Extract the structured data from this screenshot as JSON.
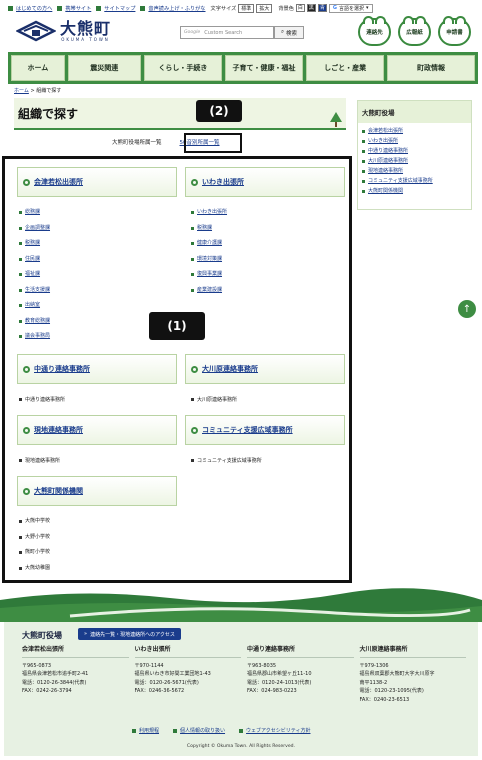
{
  "utility": {
    "links": [
      "はじめての方へ",
      "携帯サイト",
      "サイトマップ",
      "音声読み上げ・ふりがな"
    ],
    "font_size_label": "文字サイズ",
    "font_std": "標準",
    "font_large": "拡大",
    "bg_label": "背景色",
    "bg_options": [
      "白",
      "黒",
      "青"
    ],
    "lang_label": "言語を選択"
  },
  "header": {
    "logo_text": "大熊町",
    "logo_sub": "OKUMA TOWN",
    "search_placeholder": "Custom Search",
    "search_brand": "Google",
    "search_button": "検索",
    "quick_links": [
      "連絡先",
      "広報紙",
      "申請書"
    ]
  },
  "gnav": [
    "ホーム",
    "震災関連",
    "くらし・手続き",
    "子育て・健康・福祉",
    "しごと・産業",
    "町政情報"
  ],
  "breadcrumb": {
    "home": "ホーム",
    "current": "組織で探す"
  },
  "page_title": "組織で探す",
  "subnav": {
    "current": "大熊町役場所属一覧",
    "link": "50音別所属一覧"
  },
  "callouts": {
    "one": "(1)",
    "two": "(2)"
  },
  "org": {
    "aizu": {
      "title": "会津若松出張所",
      "items": [
        "総務課",
        "企画調整課",
        "税務課",
        "住民課",
        "福祉課",
        "生活支援課",
        "出納室",
        "教育総務課",
        "議会事務局"
      ]
    },
    "iwaki": {
      "title": "いわき出張所",
      "items": [
        "いわき出張所",
        "税務課",
        "健康介護課",
        "環境対策課",
        "復興事業課",
        "産業建設課"
      ]
    },
    "nakadori": {
      "title": "中通り連絡事務所",
      "items": [
        "中通り連絡事務所"
      ]
    },
    "okawara": {
      "title": "大川原連絡事務所",
      "items": [
        "大川原連絡事務所"
      ]
    },
    "genchi": {
      "title": "現地連絡事務所",
      "items": [
        "現地連絡事務所"
      ]
    },
    "community": {
      "title": "コミュニティ支援広域事務所",
      "items": [
        "コミュニティ支援広域事務所"
      ]
    },
    "kankei": {
      "title": "大熊町関係機関",
      "items": [
        "大熊中学校",
        "大野小学校",
        "熊町小学校",
        "大熊幼稚園"
      ]
    }
  },
  "side": {
    "heading": "大熊町役場",
    "items": [
      "会津若松出張所",
      "いわき出張所",
      "中通り連絡事務所",
      "大川原連絡事務所",
      "現地連絡事務所",
      "コミュニティ支援広域事務所",
      "大熊町関係機関"
    ]
  },
  "footer": {
    "title": "大熊町役場",
    "access": "連絡先一覧・現地連絡所へのアクセス",
    "columns": [
      {
        "name": "会津若松出張所",
        "lines": [
          "〒965-0873",
          "福島県会津若松市追手町2-41",
          "電話：0120-26-3844(代表)",
          "FAX：0242-26-3794"
        ]
      },
      {
        "name": "いわき出張所",
        "lines": [
          "〒970-1144",
          "福島県いわき市好間工業団地1-43",
          "電話：0120-26-5671(代表)",
          "FAX：0246-36-5672"
        ]
      },
      {
        "name": "中通り連絡事務所",
        "lines": [
          "〒963-8035",
          "福島県郡山市希望ヶ丘11-10",
          "電話：0120-24-1013(代表)",
          "FAX：024-983-0223"
        ]
      },
      {
        "name": "大川原連絡事務所",
        "lines": [
          "〒979-1306",
          "福島県双葉郡大熊町大字大川原字",
          "南平1138-2",
          "電話：0120-23-1095(代表)",
          "FAX：0240-23-6513"
        ]
      }
    ],
    "links": [
      "利用規程",
      "個人情報の取り扱い",
      "ウェブアクセシビリティ方針"
    ],
    "copyright": "Copyright © Okuma Town. All Rights Reserved."
  }
}
